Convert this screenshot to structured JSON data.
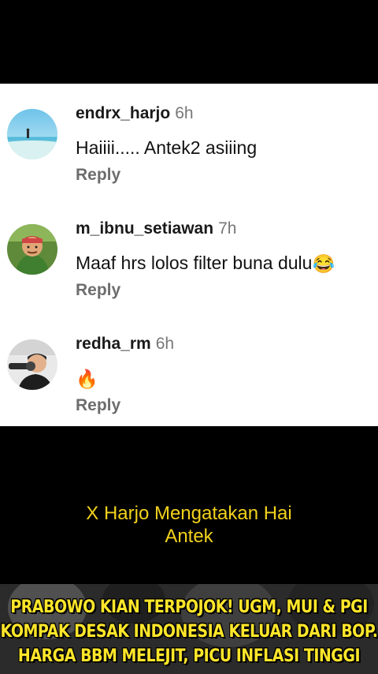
{
  "comments": [
    {
      "username": "endrx_harjo",
      "time": "6h",
      "text": "Haiiii..... Antek2 asiiing",
      "emoji": "",
      "reply_label": "Reply",
      "avatar_icon": "beach-photo-avatar"
    },
    {
      "username": "m_ibnu_setiawan",
      "time": "7h",
      "text": "Maaf hrs lolos filter buna dulu",
      "emoji": "😂",
      "reply_label": "Reply",
      "avatar_icon": "cartoon-man-avatar"
    },
    {
      "username": "redha_rm",
      "time": "6h",
      "text": "",
      "emoji": "🔥",
      "reply_label": "Reply",
      "avatar_icon": "man-with-mic-avatar"
    }
  ],
  "caption": {
    "line1": "X Harjo Mengatakan Hai",
    "line2": "Antek"
  },
  "banner": {
    "line1": "PRABOWO KIAN TERPOJOK! UGM, MUI & PGI",
    "line2": "KOMPAK DESAK INDONESIA KELUAR DARI BOP.",
    "line3": "HARGA BBM MELEJIT, PICU INFLASI TINGGI",
    "text_color": "#ffe62a"
  },
  "colors": {
    "caption": "#f2d21b",
    "reply": "#6d6d6d",
    "time": "#777777"
  }
}
